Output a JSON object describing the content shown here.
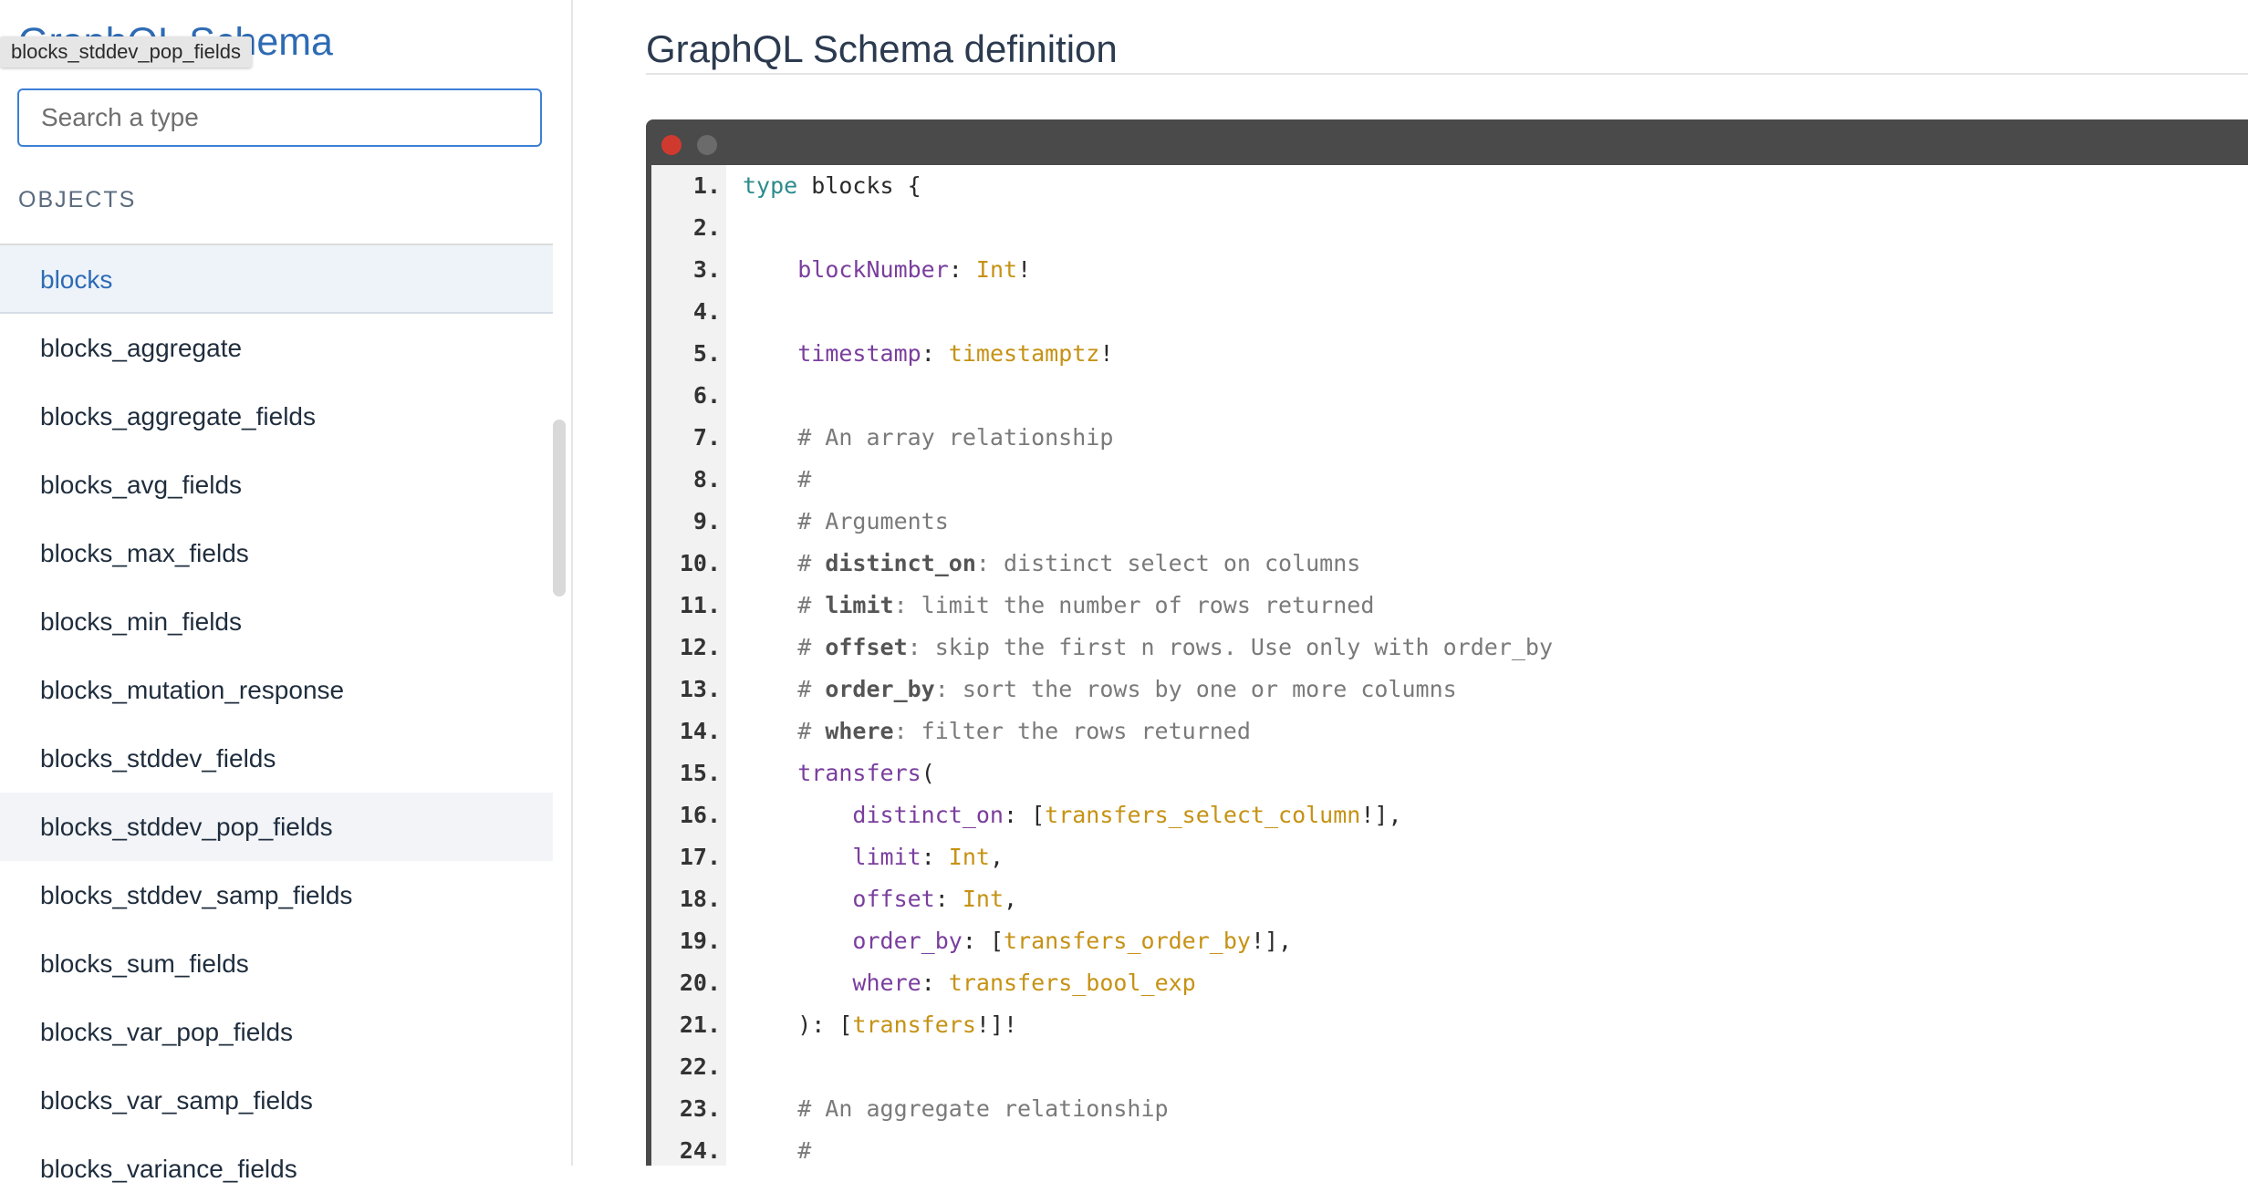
{
  "app": {
    "title": "GraphQL Schema",
    "tooltip": "blocks_stddev_pop_fields"
  },
  "search": {
    "placeholder": "Search a type",
    "value": ""
  },
  "sidebar": {
    "section_label": "OBJECTS",
    "items": [
      "blocks",
      "blocks_aggregate",
      "blocks_aggregate_fields",
      "blocks_avg_fields",
      "blocks_max_fields",
      "blocks_min_fields",
      "blocks_mutation_response",
      "blocks_stddev_fields",
      "blocks_stddev_pop_fields",
      "blocks_stddev_samp_fields",
      "blocks_sum_fields",
      "blocks_var_pop_fields",
      "blocks_var_samp_fields",
      "blocks_variance_fields"
    ],
    "active_item": "blocks",
    "hover_item": "blocks_stddev_pop_fields"
  },
  "main": {
    "title": "GraphQL Schema definition"
  },
  "colors": {
    "accent": "#2e6bb4",
    "keyword": "#2e8b8b",
    "field": "#7a3e9d",
    "type": "#c69214",
    "comment": "#7a7a7a"
  },
  "code": [
    [
      [
        "kw",
        "type"
      ],
      [
        "t",
        " blocks {"
      ]
    ],
    [],
    [
      [
        "t",
        "    "
      ],
      [
        "fld",
        "blockNumber"
      ],
      [
        "t",
        ": "
      ],
      [
        "typ",
        "Int"
      ],
      [
        "t",
        "!"
      ]
    ],
    [],
    [
      [
        "t",
        "    "
      ],
      [
        "fld",
        "timestamp"
      ],
      [
        "t",
        ": "
      ],
      [
        "typ",
        "timestamptz"
      ],
      [
        "t",
        "!"
      ]
    ],
    [],
    [
      [
        "cmt",
        "    # An array relationship"
      ]
    ],
    [
      [
        "cmt",
        "    #"
      ]
    ],
    [
      [
        "cmt",
        "    # Arguments"
      ]
    ],
    [
      [
        "cmt",
        "    # "
      ],
      [
        "cmtb",
        "distinct_on"
      ],
      [
        "cmt",
        ": distinct select on columns"
      ]
    ],
    [
      [
        "cmt",
        "    # "
      ],
      [
        "cmtb",
        "limit"
      ],
      [
        "cmt",
        ": limit the number of rows returned"
      ]
    ],
    [
      [
        "cmt",
        "    # "
      ],
      [
        "cmtb",
        "offset"
      ],
      [
        "cmt",
        ": skip the first n rows. Use only with order_by"
      ]
    ],
    [
      [
        "cmt",
        "    # "
      ],
      [
        "cmtb",
        "order_by"
      ],
      [
        "cmt",
        ": sort the rows by one or more columns"
      ]
    ],
    [
      [
        "cmt",
        "    # "
      ],
      [
        "cmtb",
        "where"
      ],
      [
        "cmt",
        ": filter the rows returned"
      ]
    ],
    [
      [
        "t",
        "    "
      ],
      [
        "fld",
        "transfers"
      ],
      [
        "t",
        "("
      ]
    ],
    [
      [
        "t",
        "        "
      ],
      [
        "fld",
        "distinct_on"
      ],
      [
        "t",
        ": ["
      ],
      [
        "typ",
        "transfers_select_column"
      ],
      [
        "t",
        "!],"
      ]
    ],
    [
      [
        "t",
        "        "
      ],
      [
        "fld",
        "limit"
      ],
      [
        "t",
        ": "
      ],
      [
        "typ",
        "Int"
      ],
      [
        "t",
        ","
      ]
    ],
    [
      [
        "t",
        "        "
      ],
      [
        "fld",
        "offset"
      ],
      [
        "t",
        ": "
      ],
      [
        "typ",
        "Int"
      ],
      [
        "t",
        ","
      ]
    ],
    [
      [
        "t",
        "        "
      ],
      [
        "fld",
        "order_by"
      ],
      [
        "t",
        ": ["
      ],
      [
        "typ",
        "transfers_order_by"
      ],
      [
        "t",
        "!],"
      ]
    ],
    [
      [
        "t",
        "        "
      ],
      [
        "fld",
        "where"
      ],
      [
        "t",
        ": "
      ],
      [
        "typ",
        "transfers_bool_exp"
      ]
    ],
    [
      [
        "t",
        "    ): ["
      ],
      [
        "typ",
        "transfers"
      ],
      [
        "t",
        "!]!"
      ]
    ],
    [],
    [
      [
        "cmt",
        "    # An aggregate relationship"
      ]
    ],
    [
      [
        "cmt",
        "    #"
      ]
    ]
  ]
}
